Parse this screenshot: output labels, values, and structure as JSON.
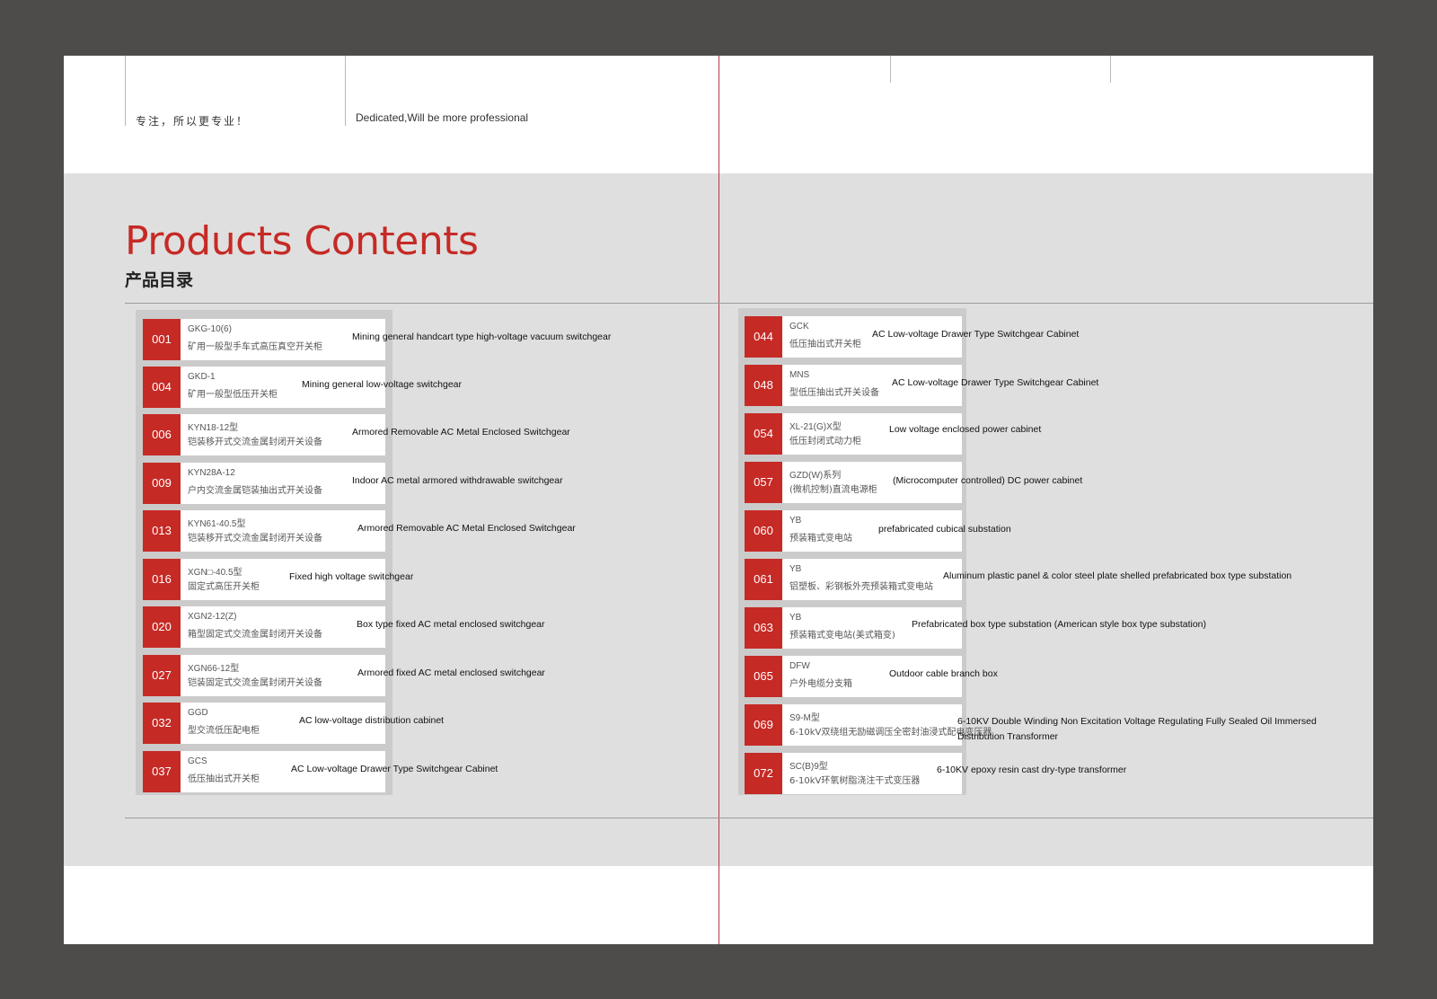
{
  "header": {
    "tagline_cn": "专注，所以更专业！",
    "tagline_en": "Dedicated,Will be more professional"
  },
  "title": "Products Contents",
  "subtitle": "产品目录",
  "left_items": [
    {
      "code": "001",
      "model": "GKG-10(6)",
      "name_cn": "矿用一般型手车式高压真空开关柜",
      "name_en": "Mining general handcart type high-voltage vacuum switchgear"
    },
    {
      "code": "004",
      "model": "GKD-1",
      "name_cn": "矿用一般型低压开关柜",
      "name_en": "Mining general low-voltage switchgear"
    },
    {
      "code": "006",
      "model": "KYN18-12型",
      "name_cn": "铠装移开式交流金属封闭开关设备",
      "name_en": "Armored Removable AC Metal Enclosed Switchgear"
    },
    {
      "code": "009",
      "model": "KYN28A-12",
      "name_cn": "户内交流金属铠装抽出式开关设备",
      "name_en": "Indoor AC metal armored withdrawable switchgear"
    },
    {
      "code": "013",
      "model": "KYN61-40.5型",
      "name_cn": "铠装移开式交流金属封闭开关设备",
      "name_en": "Armored Removable AC Metal Enclosed Switchgear"
    },
    {
      "code": "016",
      "model": "XGN□-40.5型",
      "name_cn": "固定式高压开关柜",
      "name_en": "Fixed high voltage switchgear"
    },
    {
      "code": "020",
      "model": "XGN2-12(Z)",
      "name_cn": "箱型固定式交流金属封闭开关设备",
      "name_en": "Box type fixed AC metal enclosed switchgear"
    },
    {
      "code": "027",
      "model": "XGN66-12型",
      "name_cn": "铠装固定式交流金属封闭开关设备",
      "name_en": "Armored fixed AC metal enclosed switchgear"
    },
    {
      "code": "032",
      "model": "GGD",
      "name_cn": "型交流低压配电柜",
      "name_en": "AC low-voltage distribution cabinet"
    },
    {
      "code": "037",
      "model": "GCS",
      "name_cn": "低压抽出式开关柜",
      "name_en": "AC Low-voltage Drawer Type Switchgear Cabinet"
    }
  ],
  "right_items": [
    {
      "code": "044",
      "model": "GCK",
      "name_cn": "低压抽出式开关柜",
      "name_en": "AC Low-voltage Drawer Type Switchgear Cabinet"
    },
    {
      "code": "048",
      "model": "MNS",
      "name_cn": "型低压抽出式开关设备",
      "name_en": "AC Low-voltage Drawer Type Switchgear Cabinet"
    },
    {
      "code": "054",
      "model": "XL-21(G)X型",
      "name_cn": "低压封闭式动力柜",
      "name_en": "Low voltage enclosed power cabinet"
    },
    {
      "code": "057",
      "model": "GZD(W)系列",
      "name_cn": "(微机控制)直流电源柜",
      "name_en": "(Microcomputer controlled) DC power cabinet"
    },
    {
      "code": "060",
      "model": "YB",
      "name_cn": "预装箱式变电站",
      "name_en": "prefabricated cubical substation"
    },
    {
      "code": "061",
      "model": "YB",
      "name_cn": "铝塑板、彩钢板外壳预装箱式变电站",
      "name_en": "Aluminum plastic panel & color steel plate shelled prefabricated box type substation"
    },
    {
      "code": "063",
      "model": "YB",
      "name_cn": "预装箱式变电站(美式箱变)",
      "name_en": "Prefabricated box type substation (American style box type substation)"
    },
    {
      "code": "065",
      "model": "DFW",
      "name_cn": "户外电缆分支箱",
      "name_en": "Outdoor cable branch box"
    },
    {
      "code": "069",
      "model": "S9-M型",
      "name_cn": "6-10kV双绕组无励磁调压全密封油浸式配电变压器",
      "name_en": "6-10KV Double Winding Non Excitation Voltage Regulating Fully Sealed Oil Immersed Distribution Transformer"
    },
    {
      "code": "072",
      "model": "SC(B)9型",
      "name_cn": "6-10kV环氧树脂浇注干式变压器",
      "name_en": "6-10KV epoxy resin cast dry-type transformer"
    }
  ]
}
